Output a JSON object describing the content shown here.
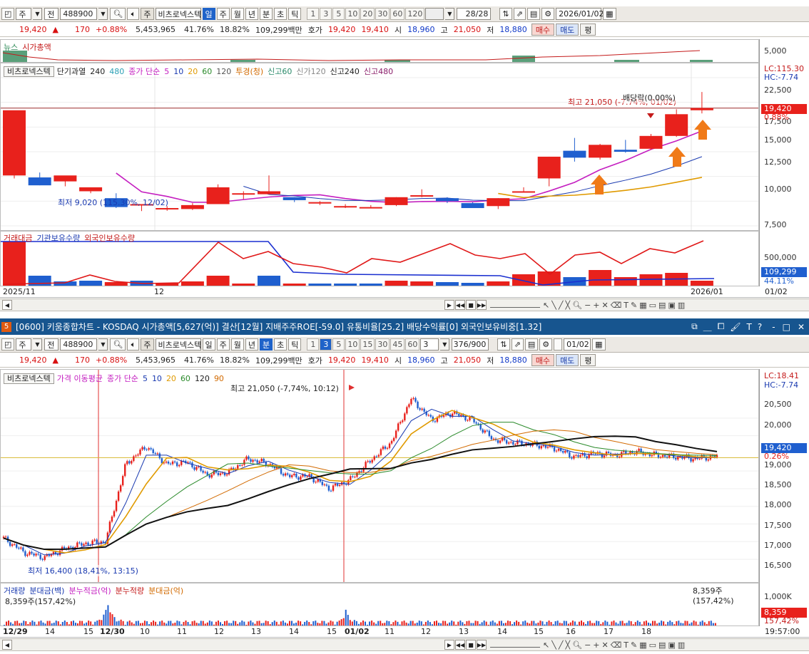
{
  "top": {
    "toolbar": {
      "type": "주",
      "market": "전",
      "code": "488900",
      "name": "비츠로넥스텍",
      "periods": [
        "일",
        "주",
        "월",
        "년",
        "분",
        "초",
        "틱"
      ],
      "selected_period": "일",
      "intervals": [
        "1",
        "3",
        "5",
        "10",
        "20",
        "30",
        "60",
        "120"
      ],
      "count": "28/28",
      "date": "2026/01/02"
    },
    "quote": {
      "price": "19,420",
      "arrow": "▲",
      "change": "170",
      "change_pct": "+0.88%",
      "volume": "5,453,965",
      "turnover_rate": "41.76%",
      "foreign_ratio": "18.82%",
      "amount": "109,299백만",
      "ask_label": "호가",
      "ask": "19,420",
      "bid": "19,410",
      "open_label": "시",
      "open": "18,960",
      "high_label": "고",
      "high": "21,050",
      "low_label": "저",
      "low": "18,880",
      "buy": "매수",
      "sell": "매도",
      "avg": "평"
    },
    "news_legend": {
      "news": "뉴스",
      "mcap": "시가총액"
    },
    "news_axis": "5,000",
    "price_legend": {
      "name": "비츠로넥스텍",
      "short": "단기과열",
      "p1": "240",
      "p2": "480",
      "ma": "종가 단순",
      "ma_periods": [
        "5",
        "10",
        "20",
        "60",
        "120"
      ],
      "tp": "투경(청)",
      "ng60": "신고60",
      "ng120": "신가120",
      "ng240": "신고240",
      "ng480": "신고480"
    },
    "price_axis": {
      "ticks": [
        "22,500",
        "17,500",
        "15,000",
        "12,500",
        "10,000",
        "7,500"
      ],
      "lc": "LC:115.30",
      "hc": "HC:-7.74",
      "last": "19,420",
      "last_pct": "0.88%"
    },
    "annotations": {
      "high": "최고 21,050 (-7.74%, 01/02)",
      "dividend": "배당락(0.00%)",
      "low": "최저 9,020 (115.30%, 12/02)"
    },
    "volume_legend": {
      "amt": "거래대금",
      "inst": "기관보유수량",
      "foreign": "외국인보유수량"
    },
    "volume_axis": {
      "ticks": [
        "500,000"
      ],
      "last": "109,299",
      "last_pct": "44.11%"
    },
    "x_labels": [
      "2025/11",
      "12"
    ],
    "x_right": "2026/01",
    "x_axis_tag": "01/02"
  },
  "window_title": {
    "number": "5",
    "text": "[0600] 키움종합차트 - KOSDAQ 시가총액[5,627(억)] 결산[12월] 지배주주ROE[-59.0] 유통비율[25.2] 배당수익률[0] 외국인보유비중[1.32]",
    "controls": [
      "⧉",
      "＿",
      "⧠",
      "🖌",
      "T",
      "?",
      "-",
      "□",
      "✕"
    ]
  },
  "bottom": {
    "toolbar": {
      "type": "주",
      "market": "전",
      "code": "488900",
      "name": "비츠로넥스텍",
      "periods": [
        "일",
        "주",
        "월",
        "년",
        "분",
        "초",
        "틱"
      ],
      "selected_period": "분",
      "intervals": [
        "1",
        "3",
        "5",
        "10",
        "15",
        "30",
        "45",
        "60"
      ],
      "interval_select": "3",
      "count": "376/900",
      "date": "01/02"
    },
    "price_legend": {
      "name": "비츠로넥스텍",
      "ma_name": "가격 이동평균",
      "ma": "종가 단순",
      "ma_periods": [
        "5",
        "10",
        "20",
        "60",
        "120",
        "90"
      ]
    },
    "price_axis": {
      "ticks": [
        "20,500",
        "20,000",
        "19,000",
        "18,500",
        "18,000",
        "17,500",
        "17,000",
        "16,500"
      ],
      "lc": "LC:18.41",
      "hc": "HC:-7.74",
      "last": "19,420",
      "last_pct": "0.26%"
    },
    "annotations": {
      "high": "최고 21,050 (-7,74%, 10:12)",
      "low": "최저 16,400 (18,41%, 13:15)"
    },
    "volume_legend": {
      "vol": "거래량",
      "mamt": "분대금(백)",
      "cum": "분누적금(억)",
      "cumv": "분누적량",
      "amt2": "분대금(억)",
      "info": "8,359주(157,42%)",
      "info_right": "8,359주(157,42%)"
    },
    "volume_axis": {
      "ticks": [
        "1,000K"
      ],
      "last": "8,359",
      "last_pct": "157,42%"
    },
    "x_labels": [
      "12/29",
      "14",
      "15",
      "12/30",
      "10",
      "11",
      "12",
      "13",
      "14",
      "15",
      "01/02",
      "11",
      "12",
      "13",
      "14",
      "15",
      "16",
      "17",
      "18"
    ],
    "time": "19:57:00"
  },
  "colors": {
    "up": "#e8211c",
    "down": "#1f5fcf",
    "accent": "#17558f"
  },
  "chart_data": [
    {
      "type": "candlestick",
      "title": "",
      "period": "daily",
      "x_labels": [
        "2025/11",
        "12",
        "2026/01"
      ],
      "candles": [
        [
          12600,
          12800,
          12300,
          19200
        ],
        [
          12400,
          12900,
          11600,
          11600
        ],
        [
          12000,
          12100,
          11500,
          12600
        ],
        [
          11000,
          11300,
          10800,
          11400
        ],
        [
          10300,
          10800,
          9300,
          9400
        ],
        [
          9600,
          9700,
          9000,
          9700
        ],
        [
          9200,
          9500,
          9020,
          9300
        ],
        [
          9200,
          9800,
          9100,
          9600
        ],
        [
          9700,
          11700,
          9700,
          11400
        ],
        [
          10800,
          11000,
          10200,
          10800
        ],
        [
          10700,
          12600,
          10700,
          11000
        ],
        [
          10400,
          10400,
          9900,
          10100
        ],
        [
          9900,
          10000,
          9600,
          9900
        ],
        [
          9500,
          9700,
          9300,
          9500
        ],
        [
          9400,
          9600,
          9300,
          9400
        ],
        [
          9600,
          10400,
          9500,
          10400
        ],
        [
          10600,
          11200,
          10400,
          10600
        ],
        [
          10300,
          10400,
          9800,
          10000
        ],
        [
          9800,
          9900,
          9400,
          9300
        ],
        [
          9500,
          10300,
          9200,
          10300
        ],
        [
          10900,
          11400,
          10900,
          11000
        ],
        [
          12300,
          14500,
          11500,
          14500
        ],
        [
          15100,
          16400,
          14000,
          14400
        ],
        [
          14400,
          15800,
          14200,
          15700
        ],
        [
          15200,
          16200,
          14900,
          15000
        ],
        [
          15300,
          16800,
          15200,
          16600
        ],
        [
          16600,
          19300,
          16500,
          18800
        ],
        [
          19200,
          21050,
          18880,
          19420
        ]
      ],
      "ylim": [
        7500,
        22500
      ],
      "volume_chart": {
        "legend": [
          "거래대금",
          "기관보유수량",
          "외국인보유수량"
        ],
        "ticks": [
          "500,000"
        ]
      }
    },
    {
      "type": "line",
      "title": "",
      "period": "3-minute",
      "x_labels": [
        "12/29",
        "14",
        "15",
        "12/30",
        "10",
        "11",
        "12",
        "13",
        "14",
        "15",
        "01/02",
        "11",
        "12",
        "13",
        "14",
        "15",
        "16",
        "17",
        "18"
      ],
      "series": [
        {
          "values": [
            17100,
            16700,
            16550,
            16800,
            16950,
            17000,
            19200,
            19700,
            19200,
            19250,
            18900,
            18950,
            19350,
            19200,
            18850,
            18850,
            18500,
            18750,
            19300,
            19800,
            21050,
            20450,
            20650,
            20450,
            19900,
            19800,
            19750,
            19650,
            19400,
            19500,
            19450,
            19550,
            19450,
            19400,
            19350,
            19420
          ]
        }
      ],
      "ylim": [
        16300,
        20900
      ],
      "annotations": {
        "high": "최고 21,050 (-7,74%, 10:12)",
        "low": "최저 16,400 (18,41%, 13:15)"
      }
    }
  ]
}
